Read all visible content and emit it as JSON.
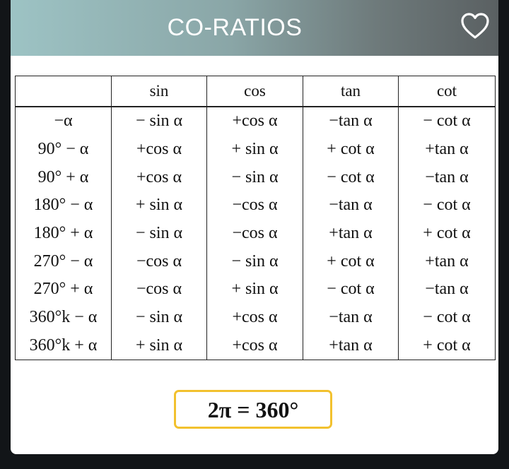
{
  "header": {
    "title": "CO-RATIOS",
    "favorite_icon": "heart-outline-icon"
  },
  "table": {
    "columns": [
      "",
      "sin",
      "cos",
      "tan",
      "cot"
    ],
    "rows": [
      [
        "−α",
        "− sin α",
        "+cos α",
        "−tan α",
        "− cot α"
      ],
      [
        "90° − α",
        "+cos α",
        "+ sin α",
        "+ cot α",
        "+tan α"
      ],
      [
        "90° + α",
        "+cos α",
        "− sin α",
        "− cot α",
        "−tan α"
      ],
      [
        "180° − α",
        "+ sin α",
        "−cos α",
        "−tan α",
        "− cot α"
      ],
      [
        "180° + α",
        "− sin α",
        "−cos α",
        "+tan α",
        "+ cot α"
      ],
      [
        "270° − α",
        "−cos α",
        "− sin α",
        "+ cot α",
        "+tan α"
      ],
      [
        "270° + α",
        "−cos α",
        "+ sin α",
        "− cot α",
        "−tan α"
      ],
      [
        "360°k − α",
        "− sin α",
        "+cos α",
        "−tan α",
        "− cot α"
      ],
      [
        "360°k + α",
        "+ sin α",
        "+cos α",
        "+tan α",
        "+ cot α"
      ]
    ]
  },
  "formula": {
    "text": "2π = 360°",
    "border_color": "#f2c12e"
  },
  "colors": {
    "header_gradient_start": "#9dc3c4",
    "header_gradient_end": "#5a6062",
    "background": "#121518"
  }
}
